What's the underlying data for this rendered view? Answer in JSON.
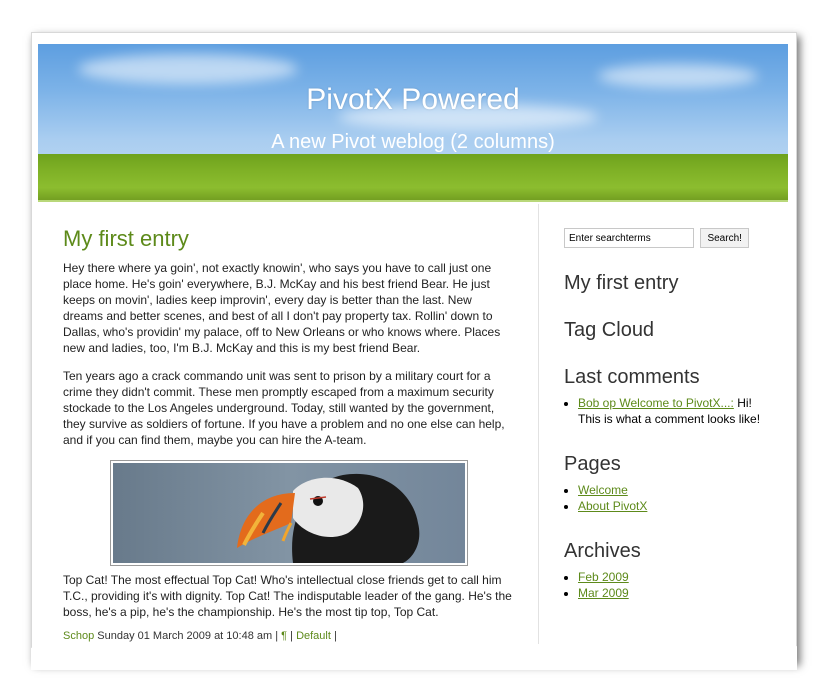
{
  "header": {
    "title": "PivotX Powered",
    "subtitle": "A new Pivot weblog (2 columns)"
  },
  "entry": {
    "title": "My first entry",
    "paragraphs": [
      "Hey there where ya goin', not exactly knowin', who says you have to call just one place home. He's goin' everywhere, B.J. McKay and his best friend Bear. He just keeps on movin', ladies keep improvin', every day is better than the last. New dreams and better scenes, and best of all I don't pay property tax. Rollin' down to Dallas, who's providin' my palace, off to New Orleans or who knows where. Places new and ladies, too, I'm B.J. McKay and this is my best friend Bear.",
      "Ten years ago a crack commando unit was sent to prison by a military court for a crime they didn't commit. These men promptly escaped from a maximum security stockade to the Los Angeles underground. Today, still wanted by the government, they survive as soldiers of fortune. If you have a problem and no one else can help, and if you can find them, maybe you can hire the A-team.",
      "Top Cat! The most effectual Top Cat! Who's intellectual close friends get to call him T.C., providing it's with dignity. Top Cat! The indisputable leader of the gang. He's the boss, he's a pip, he's the championship. He's the most tip top, Top Cat."
    ],
    "meta": {
      "author": "Schop",
      "date": "Sunday 01 March 2009 at 10:48 am",
      "sep1": " | ",
      "permalink": "¶",
      "sep2": " | ",
      "category": "Default",
      "sep3": " |"
    },
    "image_icon": "puffin-photo"
  },
  "sidebar": {
    "search": {
      "placeholder": "Enter searchterms",
      "value": "Enter searchterms",
      "button": "Search!"
    },
    "headings": {
      "latest": "My first entry",
      "tagcloud": "Tag Cloud",
      "comments": "Last comments",
      "pages": "Pages",
      "archives": "Archives"
    },
    "comment": {
      "link": "Bob op Welcome to PivotX...:",
      "text": " Hi! This is what a comment looks like!"
    },
    "pages": [
      "Welcome",
      "About PivotX"
    ],
    "archives": [
      "Feb 2009",
      "Mar 2009"
    ]
  },
  "colors": {
    "accent": "#5d8a1a",
    "sky": "#7db3e8",
    "grass": "#7fb126"
  }
}
